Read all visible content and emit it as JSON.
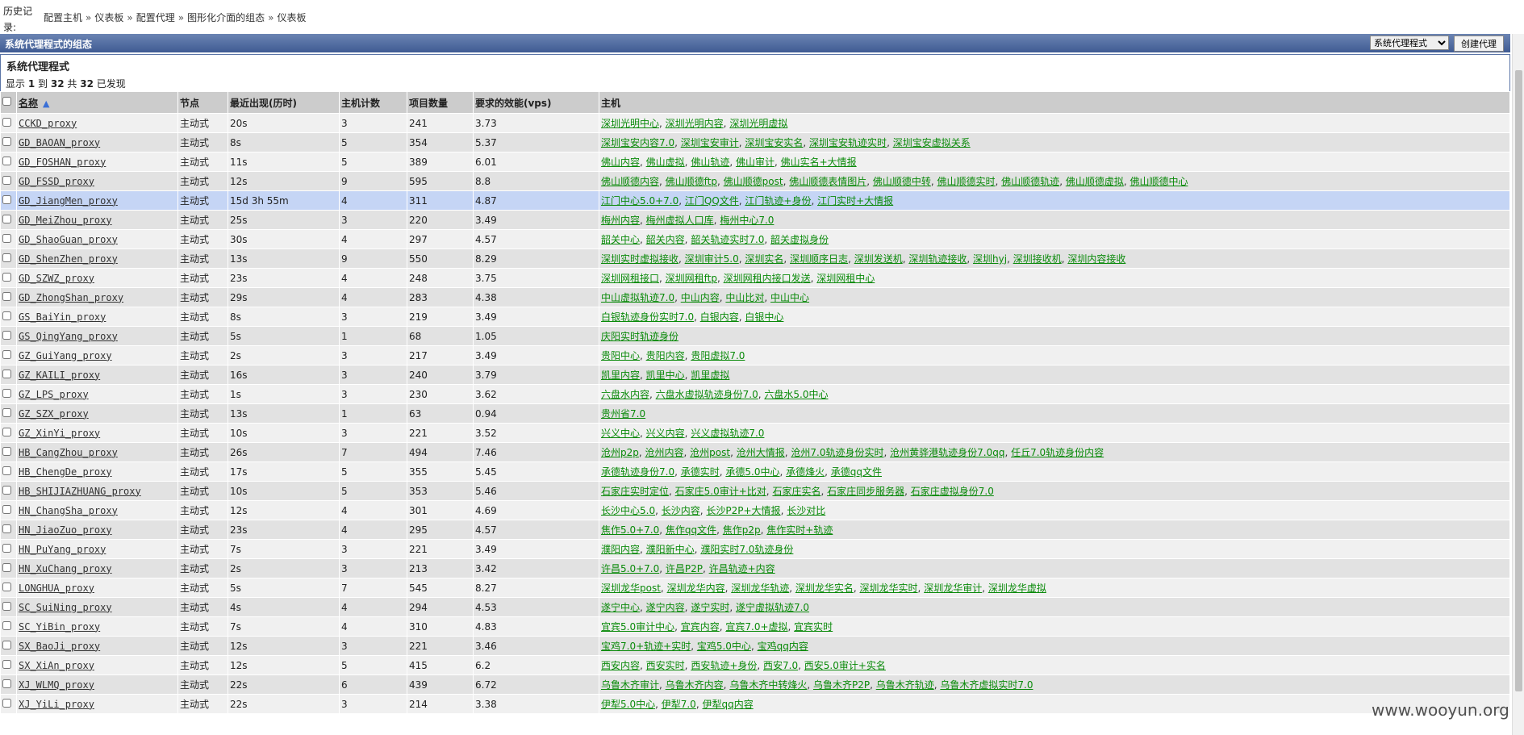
{
  "breadcrumb": {
    "label": "历史记录:",
    "items": [
      "配置主机",
      "仪表板",
      "配置代理",
      "图形化介面的组态",
      "仪表板"
    ],
    "separator": "»"
  },
  "titlebar": {
    "title": "系统代理程式的组态",
    "select_value": "系统代理程式",
    "create_button": "创建代理"
  },
  "panel": {
    "heading": "系统代理程式",
    "count_prefix": "显示",
    "from": "1",
    "to_word": "到",
    "to": "32",
    "total_word": "共",
    "total": "32",
    "found_word": "已发现"
  },
  "columns": [
    "名称",
    "节点",
    "最近出现(历时)",
    "主机计数",
    "项目数量",
    "要求的效能(vps)",
    "主机"
  ],
  "sort_icon": "sort-asc-icon",
  "rows": [
    {
      "name": "CCKD_proxy",
      "mode": "主动式",
      "seen": "20s",
      "hosts_count": "3",
      "items": "241",
      "vps": "3.73",
      "hosts": [
        "深圳光明中心",
        "深圳光明内容",
        "深圳光明虚拟"
      ]
    },
    {
      "name": "GD_BAOAN_proxy",
      "mode": "主动式",
      "seen": "8s",
      "hosts_count": "5",
      "items": "354",
      "vps": "5.37",
      "hosts": [
        "深圳宝安内容7.0",
        "深圳宝安审计",
        "深圳宝安实名",
        "深圳宝安轨迹实时",
        "深圳宝安虚拟关系"
      ]
    },
    {
      "name": "GD_FOSHAN_proxy",
      "mode": "主动式",
      "seen": "11s",
      "hosts_count": "5",
      "items": "389",
      "vps": "6.01",
      "hosts": [
        "佛山内容",
        "佛山虚拟",
        "佛山轨迹",
        "佛山审计",
        "佛山实名+大情报"
      ]
    },
    {
      "name": "GD_FSSD_proxy",
      "mode": "主动式",
      "seen": "12s",
      "hosts_count": "9",
      "items": "595",
      "vps": "8.8",
      "hosts": [
        "佛山顺德内容",
        "佛山顺德ftp",
        "佛山顺德post",
        "佛山顺德表情图片",
        "佛山顺德中转",
        "佛山顺德实时",
        "佛山顺德轨迹",
        "佛山顺德虚拟",
        "佛山顺德中心"
      ]
    },
    {
      "name": "GD_JiangMen_proxy",
      "mode": "主动式",
      "seen": "15d 3h 55m",
      "hosts_count": "4",
      "items": "311",
      "vps": "4.87",
      "hosts": [
        "江门中心5.0+7.0",
        "江门QQ文件",
        "江门轨迹+身份",
        "江门实时+大情报"
      ],
      "highlight": true
    },
    {
      "name": "GD_MeiZhou_proxy",
      "mode": "主动式",
      "seen": "25s",
      "hosts_count": "3",
      "items": "220",
      "vps": "3.49",
      "hosts": [
        "梅州内容",
        "梅州虚拟人口库",
        "梅州中心7.0"
      ]
    },
    {
      "name": "GD_ShaoGuan_proxy",
      "mode": "主动式",
      "seen": "30s",
      "hosts_count": "4",
      "items": "297",
      "vps": "4.57",
      "hosts": [
        "韶关中心",
        "韶关内容",
        "韶关轨迹实时7.0",
        "韶关虚拟身份"
      ]
    },
    {
      "name": "GD_ShenZhen_proxy",
      "mode": "主动式",
      "seen": "13s",
      "hosts_count": "9",
      "items": "550",
      "vps": "8.29",
      "hosts": [
        "深圳实时虚拟接收",
        "深圳审计5.0",
        "深圳实名",
        "深圳顺序日志",
        "深圳发送机",
        "深圳轨迹接收",
        "深圳hyj",
        "深圳接收机",
        "深圳内容接收"
      ]
    },
    {
      "name": "GD_SZWZ_proxy",
      "mode": "主动式",
      "seen": "23s",
      "hosts_count": "4",
      "items": "248",
      "vps": "3.75",
      "hosts": [
        "深圳网租接口",
        "深圳网租ftp",
        "深圳网租内接口发送",
        "深圳网租中心"
      ]
    },
    {
      "name": "GD_ZhongShan_proxy",
      "mode": "主动式",
      "seen": "29s",
      "hosts_count": "4",
      "items": "283",
      "vps": "4.38",
      "hosts": [
        "中山虚拟轨迹7.0",
        "中山内容",
        "中山比对",
        "中山中心"
      ]
    },
    {
      "name": "GS_BaiYin_proxy",
      "mode": "主动式",
      "seen": "8s",
      "hosts_count": "3",
      "items": "219",
      "vps": "3.49",
      "hosts": [
        "白银轨迹身份实时7.0",
        "白银内容",
        "白银中心"
      ]
    },
    {
      "name": "GS_QingYang_proxy",
      "mode": "主动式",
      "seen": "5s",
      "hosts_count": "1",
      "items": "68",
      "vps": "1.05",
      "hosts": [
        "庆阳实时轨迹身份"
      ]
    },
    {
      "name": "GZ_GuiYang_proxy",
      "mode": "主动式",
      "seen": "2s",
      "hosts_count": "3",
      "items": "217",
      "vps": "3.49",
      "hosts": [
        "贵阳中心",
        "贵阳内容",
        "贵阳虚拟7.0"
      ]
    },
    {
      "name": "GZ_KAILI_proxy",
      "mode": "主动式",
      "seen": "16s",
      "hosts_count": "3",
      "items": "240",
      "vps": "3.79",
      "hosts": [
        "凯里内容",
        "凯里中心",
        "凯里虚拟"
      ]
    },
    {
      "name": "GZ_LPS_proxy",
      "mode": "主动式",
      "seen": "1s",
      "hosts_count": "3",
      "items": "230",
      "vps": "3.62",
      "hosts": [
        "六盘水内容",
        "六盘水虚拟轨迹身份7.0",
        "六盘水5.0中心"
      ]
    },
    {
      "name": "GZ_SZX_proxy",
      "mode": "主动式",
      "seen": "13s",
      "hosts_count": "1",
      "items": "63",
      "vps": "0.94",
      "hosts": [
        "贵州省7.0"
      ]
    },
    {
      "name": "GZ_XinYi_proxy",
      "mode": "主动式",
      "seen": "10s",
      "hosts_count": "3",
      "items": "221",
      "vps": "3.52",
      "hosts": [
        "兴义中心",
        "兴义内容",
        "兴义虚拟轨迹7.0"
      ]
    },
    {
      "name": "HB_CangZhou_proxy",
      "mode": "主动式",
      "seen": "26s",
      "hosts_count": "7",
      "items": "494",
      "vps": "7.46",
      "hosts": [
        "沧州p2p",
        "沧州内容",
        "沧州post",
        "沧州大情报",
        "沧州7.0轨迹身份实时",
        "沧州黄骅港轨迹身份7.0qq",
        "任丘7.0轨迹身份内容"
      ]
    },
    {
      "name": "HB_ChengDe_proxy",
      "mode": "主动式",
      "seen": "17s",
      "hosts_count": "5",
      "items": "355",
      "vps": "5.45",
      "hosts": [
        "承德轨迹身份7.0",
        "承德实时",
        "承德5.0中心",
        "承德烽火",
        "承德qq文件"
      ]
    },
    {
      "name": "HB_SHIJIAZHUANG_proxy",
      "mode": "主动式",
      "seen": "10s",
      "hosts_count": "5",
      "items": "353",
      "vps": "5.46",
      "hosts": [
        "石家庄实时定位",
        "石家庄5.0审计+比对",
        "石家庄实名",
        "石家庄同步服务器",
        "石家庄虚拟身份7.0"
      ]
    },
    {
      "name": "HN_ChangSha_proxy",
      "mode": "主动式",
      "seen": "12s",
      "hosts_count": "4",
      "items": "301",
      "vps": "4.69",
      "hosts": [
        "长沙中心5.0",
        "长沙内容",
        "长沙P2P+大情报",
        "长沙对比"
      ]
    },
    {
      "name": "HN_JiaoZuo_proxy",
      "mode": "主动式",
      "seen": "23s",
      "hosts_count": "4",
      "items": "295",
      "vps": "4.57",
      "hosts": [
        "焦作5.0+7.0",
        "焦作qq文件",
        "焦作p2p",
        "焦作实时+轨迹"
      ]
    },
    {
      "name": "HN_PuYang_proxy",
      "mode": "主动式",
      "seen": "7s",
      "hosts_count": "3",
      "items": "221",
      "vps": "3.49",
      "hosts": [
        "濮阳内容",
        "濮阳新中心",
        "濮阳实时7.0轨迹身份"
      ]
    },
    {
      "name": "HN_XuChang_proxy",
      "mode": "主动式",
      "seen": "2s",
      "hosts_count": "3",
      "items": "213",
      "vps": "3.42",
      "hosts": [
        "许昌5.0+7.0",
        "许昌P2P",
        "许昌轨迹+内容"
      ]
    },
    {
      "name": "LONGHUA_proxy",
      "mode": "主动式",
      "seen": "5s",
      "hosts_count": "7",
      "items": "545",
      "vps": "8.27",
      "hosts": [
        "深圳龙华post",
        "深圳龙华内容",
        "深圳龙华轨迹",
        "深圳龙华实名",
        "深圳龙华实时",
        "深圳龙华审计",
        "深圳龙华虚拟"
      ]
    },
    {
      "name": "SC_SuiNing_proxy",
      "mode": "主动式",
      "seen": "4s",
      "hosts_count": "4",
      "items": "294",
      "vps": "4.53",
      "hosts": [
        "遂宁中心",
        "遂宁内容",
        "遂宁实时",
        "遂宁虚拟轨迹7.0"
      ]
    },
    {
      "name": "SC_YiBin_proxy",
      "mode": "主动式",
      "seen": "7s",
      "hosts_count": "4",
      "items": "310",
      "vps": "4.83",
      "hosts": [
        "宜宾5.0审计中心",
        "宜宾内容",
        "宜宾7.0+虚拟",
        "宜宾实时"
      ]
    },
    {
      "name": "SX_BaoJi_proxy",
      "mode": "主动式",
      "seen": "12s",
      "hosts_count": "3",
      "items": "221",
      "vps": "3.46",
      "hosts": [
        "宝鸡7.0+轨迹+实时",
        "宝鸡5.0中心",
        "宝鸡qq内容"
      ]
    },
    {
      "name": "SX_XiAn_proxy",
      "mode": "主动式",
      "seen": "12s",
      "hosts_count": "5",
      "items": "415",
      "vps": "6.2",
      "hosts": [
        "西安内容",
        "西安实时",
        "西安轨迹+身份",
        "西安7.0",
        "西安5.0审计+实名"
      ]
    },
    {
      "name": "XJ_WLMQ_proxy",
      "mode": "主动式",
      "seen": "22s",
      "hosts_count": "6",
      "items": "439",
      "vps": "6.72",
      "hosts": [
        "乌鲁木齐审计",
        "乌鲁木齐内容",
        "乌鲁木齐中转烽火",
        "乌鲁木齐P2P",
        "乌鲁木齐轨迹",
        "乌鲁木齐虚拟实时7.0"
      ]
    },
    {
      "name": "XJ_YiLi_proxy",
      "mode": "主动式",
      "seen": "22s",
      "hosts_count": "3",
      "items": "214",
      "vps": "3.38",
      "hosts": [
        "伊犁5.0中心",
        "伊犁7.0",
        "伊犁qq内容"
      ]
    }
  ],
  "watermark": "www.wooyun.org",
  "colors": {
    "header_bar": "#4a6499",
    "link_green": "#0a8a0a",
    "row_highlight": "#c5d5f5"
  }
}
